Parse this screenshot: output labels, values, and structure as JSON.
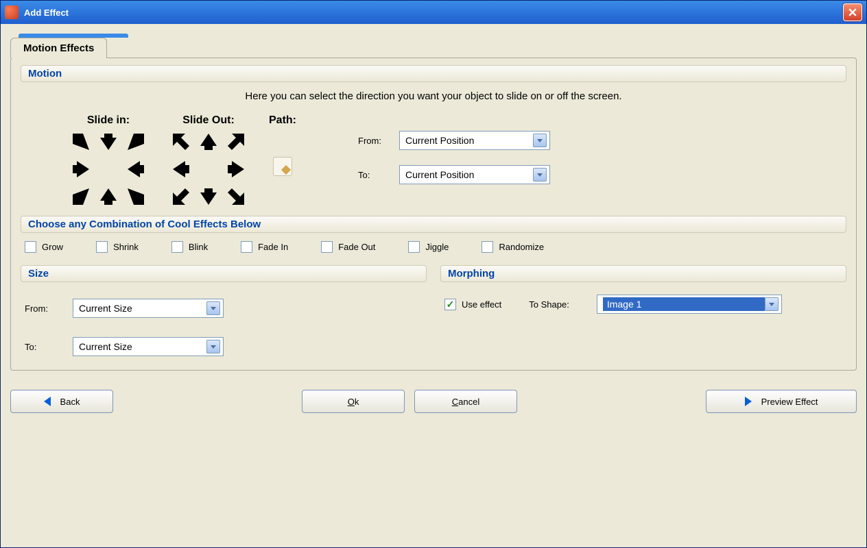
{
  "window": {
    "title": "Add Effect"
  },
  "tab": {
    "label": "Motion Effects"
  },
  "motion": {
    "header": "Motion",
    "description": "Here you can select the direction you want your object to slide on or off the screen.",
    "slide_in_label": "Slide in:",
    "slide_out_label": "Slide Out:",
    "path_label": "Path:",
    "from_label": "From:",
    "to_label": "To:",
    "from_value": "Current Position",
    "to_value": "Current Position"
  },
  "effects": {
    "header": "Choose any Combination of Cool Effects Below",
    "grow": "Grow",
    "shrink": "Shrink",
    "blink": "Blink",
    "fade_in": "Fade In",
    "fade_out": "Fade Out",
    "jiggle": "Jiggle",
    "randomize": "Randomize"
  },
  "size": {
    "header": "Size",
    "from_label": "From:",
    "to_label": "To:",
    "from_value": "Current Size",
    "to_value": "Current Size"
  },
  "morph": {
    "header": "Morphing",
    "use_effect_label": "Use effect",
    "use_effect_checked": true,
    "to_shape_label": "To Shape:",
    "to_shape_value": "Image 1"
  },
  "buttons": {
    "back": "Back",
    "ok_u": "O",
    "ok_rest": "k",
    "cancel_u": "C",
    "cancel_rest": "ancel",
    "preview": "Preview Effect"
  }
}
